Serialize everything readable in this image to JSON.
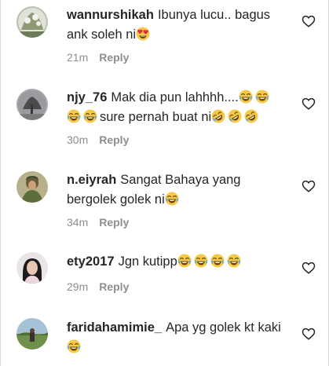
{
  "comments": [
    {
      "username": "wannurshikah",
      "text": "Ibunya lucu.. bagus ank soleh ni",
      "emojis": [
        "heart-eyes"
      ],
      "time": "21m",
      "reply_label": "Reply"
    },
    {
      "username": "njy_76",
      "text": "Mak dia pun lahhhh....",
      "text2": "sure pernah buat ni",
      "emojis_a": [
        "joy",
        "joy",
        "joy",
        "joy"
      ],
      "emojis_b": [
        "rofl",
        "rofl",
        "rofl"
      ],
      "time": "30m",
      "reply_label": "Reply"
    },
    {
      "username": "n.eiyrah",
      "text": "Sangat Bahaya yang bergolek golek ni",
      "emojis": [
        "joy"
      ],
      "time": "34m",
      "reply_label": "Reply"
    },
    {
      "username": "ety2017",
      "text": "Jgn kutipp",
      "emojis": [
        "joy",
        "joy",
        "joy",
        "joy"
      ],
      "time": "29m",
      "reply_label": "Reply"
    },
    {
      "username": "faridahamimie_",
      "text": "Apa yg golek kt kaki",
      "emojis": [
        "joy"
      ],
      "time": "",
      "reply_label": ""
    }
  ],
  "icons": {
    "like": "heart-outline-icon"
  },
  "colors": {
    "text": "#262626",
    "muted": "#8e8e8e",
    "emoji_yellow": "#f7c948"
  }
}
